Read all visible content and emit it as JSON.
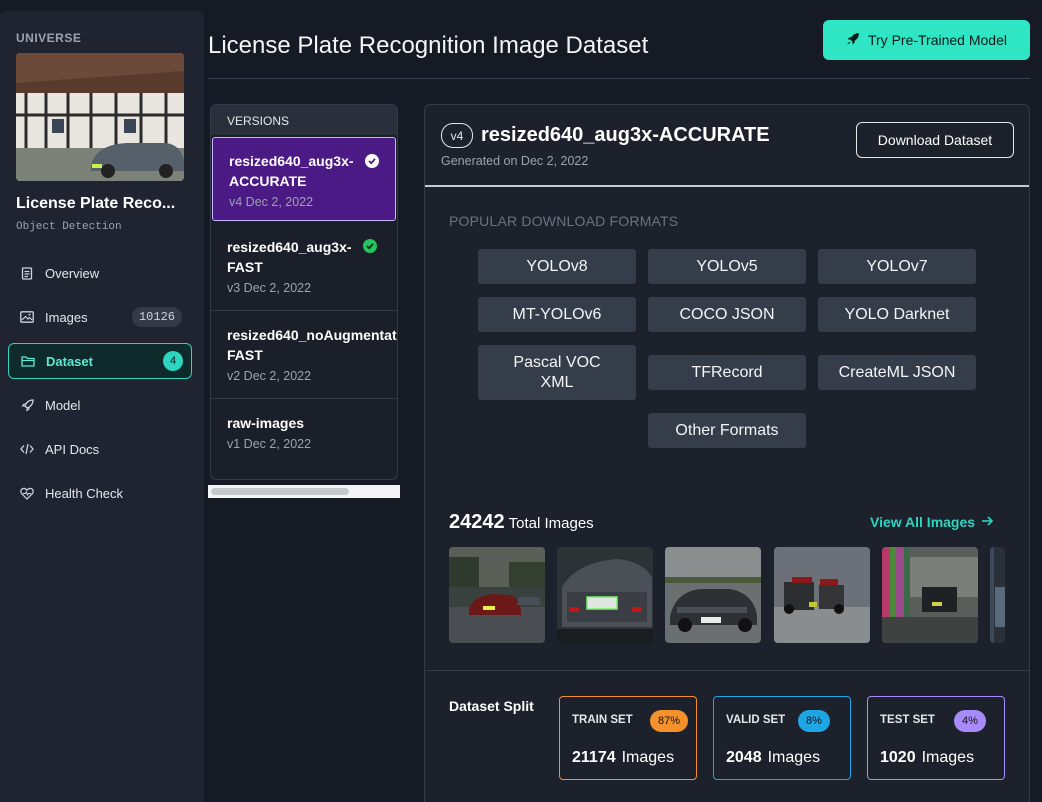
{
  "sidebar": {
    "brand": "UNIVERSE",
    "project_name": "License Plate Reco...",
    "project_type": "Object Detection",
    "items": [
      {
        "label": "Overview",
        "icon": "document-icon"
      },
      {
        "label": "Images",
        "icon": "images-icon",
        "count": "10126"
      },
      {
        "label": "Dataset",
        "icon": "folder-icon",
        "count": "4"
      },
      {
        "label": "Model",
        "icon": "rocket-icon"
      },
      {
        "label": "API Docs",
        "icon": "code-icon"
      },
      {
        "label": "Health Check",
        "icon": "heart-pulse-icon"
      }
    ]
  },
  "header": {
    "title": "License Plate Recognition Image Dataset",
    "try_button": "Try Pre-Trained Model"
  },
  "versions": {
    "heading": "VERSIONS",
    "items": [
      {
        "name": "resized640_aug3x-\nACCURATE",
        "meta": "v4 Dec 2, 2022"
      },
      {
        "name": "resized640_aug3x-\nFAST",
        "meta": "v3 Dec 2, 2022"
      },
      {
        "name": "resized640_noAugmentat\nFAST",
        "meta": "v2 Dec 2, 2022"
      },
      {
        "name": "raw-images",
        "meta": "v1 Dec 2, 2022"
      }
    ]
  },
  "version_detail": {
    "badge": "v4",
    "title": "resized640_aug3x-ACCURATE",
    "generated": "Generated on Dec 2, 2022",
    "download_button": "Download Dataset",
    "formats_heading": "POPULAR DOWNLOAD FORMATS",
    "formats": [
      "YOLOv8",
      "YOLOv5",
      "YOLOv7",
      "MT-YOLOv6",
      "COCO JSON",
      "YOLO Darknet",
      "Pascal VOC XML",
      "TFRecord",
      "CreateML JSON",
      "Other Formats"
    ],
    "total_images": "24242",
    "total_label": "Total Images",
    "view_all": "View All Images",
    "split_heading": "Dataset Split",
    "splits": [
      {
        "label": "TRAIN SET",
        "pct": "87%",
        "count": "21174",
        "unit": "Images",
        "color": "#f5912d"
      },
      {
        "label": "VALID SET",
        "pct": "8%",
        "count": "2048",
        "unit": "Images",
        "color": "#1ea6e4"
      },
      {
        "label": "TEST SET",
        "pct": "4%",
        "count": "1020",
        "unit": "Images",
        "color": "#a78bfa"
      }
    ]
  },
  "colors": {
    "accent": "#2ee6c3",
    "active_version": "#4c1a85",
    "background": "#161a24"
  }
}
